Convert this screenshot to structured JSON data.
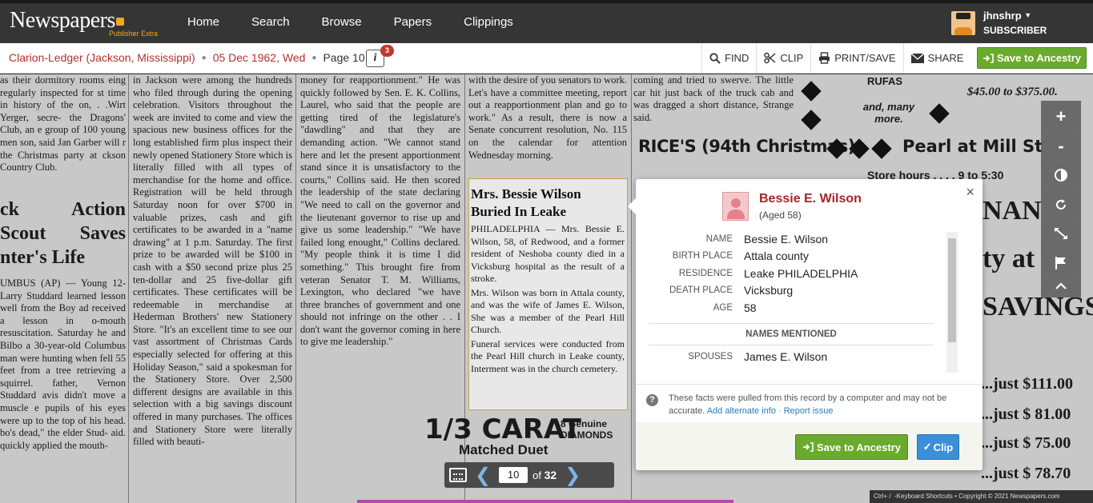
{
  "header": {
    "logo_text": "Newspapers",
    "logo_sub": "Publisher Extra",
    "nav": [
      "Home",
      "Search",
      "Browse",
      "Papers",
      "Clippings"
    ],
    "user": {
      "name": "jhnshrp",
      "level": "SUBSCRIBER"
    }
  },
  "toolbar": {
    "paper": "Clarion-Ledger (Jackson, Mississippi)",
    "date": "05 Dec 1962, Wed",
    "page": "Page 10",
    "info_badge": "3",
    "tools": [
      "FIND",
      "CLIP",
      "PRINT/SAVE",
      "SHARE"
    ],
    "save_label": "Save to Ancestry"
  },
  "viewer": {
    "zoom_controls": [
      "plus-icon",
      "minus-icon",
      "contrast-icon",
      "rotate-icon",
      "fullscreen-icon",
      "flag-icon",
      "collapse-icon"
    ],
    "pager": {
      "current": "10",
      "of_label": "of",
      "total": "32"
    },
    "footer": "Ctrl+ /  -Keyboard Shortcuts • Copyright © 2021 Newspapers.com"
  },
  "article": {
    "headline": "Mrs. Bessie Wilson Buried In Leake",
    "body": "PHILADELPHIA — Mrs. Bessie E. Wilson, 58, of Redwood, and a former resident of Neshoba county died in a Vicksburg hospital as the result of a stroke.",
    "body2": "Mrs. Wilson was born in Attala county, and was the wife of James E. Wilson, She was a member of the Pearl Hill Church.",
    "body3": "Funeral services were conducted from the Pearl Hill church in Leake county, Interment was in the church cemetery."
  },
  "newspaper": {
    "col1": {
      "top": "as their dormitory rooms eing regularly inspected for st time in history of the on, . .Wirt Yerger, secre- the Dragons' Club, an e group of 100 young men son, said Jan Garber will r the Christmas party at ckson Country Club.",
      "headline": "ck Action Scout Saves nter's Life",
      "body": "UMBUS (AP) — Young 12- Larry Studdard learned lesson well from the Boy ad received a lesson in o-mouth resuscitation. Saturday he and Bilbo a 30-year-old Columbus man were hunting when fell 55 feet from a tree retrieving a squirrel. father, Vernon Studdard avis didn't move a muscle e pupils of his eyes were up to the top of his head. bo's dead,\" the elder Stud- aid. quickly applied the mouth-"
    },
    "col2": "in Jackson were among the hundreds who filed through during the opening celebration. Visitors throughout the week are invited to come and view the spacious new business offices for the long established firm plus inspect their newly opened Stationery Store which is literally filled with all types of merchandise for the home and office. Registration will be held through Saturday noon for over $700 in valuable prizes, cash and gift certificates to be awarded in a \"name drawing\" at 1 p.m. Saturday. The first prize to be awarded will be $100 in cash with a $50 second prize plus 25 ten-dollar and 25 five-dollar gift certificates. These certificates will be redeemable in merchandise at Hederman Brothers' new Stationery Store. \"It's an excellent time to see our vast assortment of Christmas Cards especially selected for offering at this Holiday Season,\" said a spokesman for the Stationery Store. Over 2,500 different designs are available in this selection with a big savings discount offered in many purchases. The offices and Stationery Store were literally filled with beauti-",
    "col3": "money for reapportionment.\" He was quickly followed by Sen. E. K. Collins, Laurel, who said that the people are getting tired of the legislature's \"dawdling\" and that they are demanding action. \"We cannot stand here and let the present apportionment stand since it is unsatisfactory to the courts,\" Collins said. He then scored the leadership of the state declaring \"We need to call on the governor and the lieutenant governor to rise up and give us some leadership.\" \"We have failed long enought,\" Collins declared. \"My people think it is time I did something.\" This brought fire from veteran Senator T. M. Williams, Lexington, who declared \"we have three branches of government and one should not infringe on the other . . I don't want the governor coming in here to give me leadership.\"",
    "col4": "with the desire of you senators to work. Let's have a committee meeting, report out a reapportionment plan and go to work.\" As a result, there is now a Senate concurrent resolution, No. 115 on the calendar for attention Wednesday morning.",
    "col5": "coming and tried to swerve. The little car hit just back of the truck cab and was dragged a short distance, Strange said.",
    "ad_rufas": "RUFAS",
    "ad_and_many": "and, many more.",
    "ad_price": "$45.00 to $375.00.",
    "ad_rice": "RICE'S (94th Christmas)",
    "ad_pearl": "Pearl at Mill Stre",
    "ad_hours": "Store hours . . . . 9 to 5:30",
    "ad_nant": "NAN'",
    "ad_ty": "ty at",
    "ad_savings": "SAVINGS",
    "ad_carat": "1/3 CARAT",
    "ad_genuine": "8 Genuine DIAMONDS",
    "ad_matched": "Matched Duet",
    "ad_prices": [
      "...just $111.00",
      "...just $ 81.00",
      "...just $ 75.00",
      "...just $ 78.70"
    ]
  },
  "popup": {
    "name": "Bessie E. Wilson",
    "age_line": "(Aged 58)",
    "facts": [
      {
        "label": "NAME",
        "value": "Bessie E. Wilson"
      },
      {
        "label": "BIRTH PLACE",
        "value": "Attala county"
      },
      {
        "label": "RESIDENCE",
        "value": "Leake PHILADELPHIA"
      },
      {
        "label": "DEATH PLACE",
        "value": "Vicksburg"
      },
      {
        "label": "AGE",
        "value": "58"
      }
    ],
    "mentioned_heading": "NAMES MENTIONED",
    "spouses_label": "SPOUSES",
    "spouses_value": "James E. Wilson",
    "note": "These facts were pulled from this record by a computer and may not be accurate.",
    "add_info": "Add alternate info",
    "separator": "·",
    "report": "Report issue",
    "save_label": "Save to Ancestry",
    "clip_label": "Clip"
  }
}
